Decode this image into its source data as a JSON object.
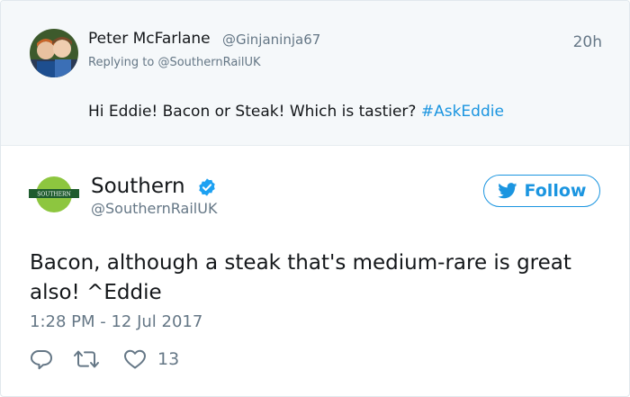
{
  "parent_tweet": {
    "author_name": "Peter McFarlane",
    "author_handle": "@Ginjaninja67",
    "time": "20h",
    "replying_to_prefix": "Replying to ",
    "replying_to_handle": "@SouthernRailUK",
    "text": "Hi Eddie! Bacon or Steak! Which is tastier? ",
    "hashtag": "#AskEddie"
  },
  "main_tweet": {
    "author_name": "Southern",
    "author_handle": "@SouthernRailUK",
    "logo_text": "SOUTHERN",
    "verified": true,
    "follow_label": "Follow",
    "text": "Bacon, although a steak that's medium-rare is great also! ^Eddie",
    "timestamp": "1:28 PM - 12 Jul 2017",
    "like_count": "13"
  },
  "colors": {
    "link_blue": "#1b95e0",
    "gray_text": "#657786",
    "southern_green": "#8dc63f",
    "southern_dark": "#1f5c2e"
  },
  "icons": [
    "reply-icon",
    "retweet-icon",
    "heart-icon",
    "twitter-bird-icon",
    "verified-badge-icon"
  ]
}
